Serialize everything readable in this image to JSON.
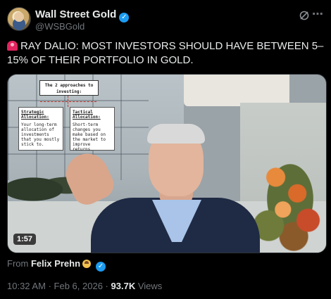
{
  "author": {
    "name": "Wall Street Gold",
    "handle": "@WSBGold",
    "verified": true
  },
  "tweet": {
    "text": "RAY DALIO: MOST INVESTORS SHOULD HAVE BETWEEN 5–15% OF THEIR PORTFOLIO IN GOLD."
  },
  "media": {
    "duration": "1:57",
    "diagram": {
      "title": "The 2 approaches to investing:",
      "left_heading": "Strategic Allocation:",
      "left_body": "Your long-term allocation of investments that you mostly stick to.",
      "right_heading": "Tactical Allocation:",
      "right_body": "Short-term changes you make based on the market to improve returns."
    }
  },
  "attribution": {
    "prefix": "From",
    "author": "Felix Prehn"
  },
  "meta": {
    "time": "10:32 AM",
    "separator": "·",
    "date": "Feb 6, 2026",
    "views_count": "93.7K",
    "views_label": "Views"
  },
  "icons": {
    "header_right": "grok-icon",
    "verified": "verified-badge-icon",
    "siren": "police-light-emoji",
    "attribution_emoji": "face-emoji"
  },
  "colors": {
    "background": "#000000",
    "text": "#e7e9ea",
    "muted": "#71767b",
    "verified": "#1d9bf0"
  }
}
